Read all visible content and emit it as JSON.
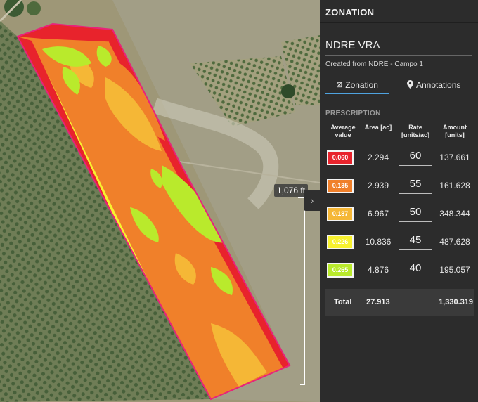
{
  "map": {
    "scale_label": "1,076 ft",
    "zone_colors": [
      "#e8232c",
      "#f0802a",
      "#f5b736",
      "#f8f22f",
      "#b9ea2c"
    ]
  },
  "panel": {
    "header": "ZONATION",
    "title": "NDRE VRA",
    "subtitle": "Created from NDRE - Campo 1",
    "tabs": [
      {
        "label": "Zonation",
        "icon": "zonation-icon"
      },
      {
        "label": "Annotations",
        "icon": "map-pin-icon"
      }
    ],
    "section": "PRESCRIPTION",
    "columns": {
      "avg": "Average value",
      "area": "Area [ac]",
      "rate": "Rate [units/ac]",
      "amount": "Amount [units]"
    },
    "rows": [
      {
        "value": "0.060",
        "color": "#e8232c",
        "area": "2.294",
        "rate": "60",
        "amount": "137.661"
      },
      {
        "value": "0.135",
        "color": "#f0802a",
        "area": "2.939",
        "rate": "55",
        "amount": "161.628"
      },
      {
        "value": "0.187",
        "color": "#f5b736",
        "area": "6.967",
        "rate": "50",
        "amount": "348.344"
      },
      {
        "value": "0.226",
        "color": "#f8f22f",
        "area": "10.836",
        "rate": "45",
        "amount": "487.628"
      },
      {
        "value": "0.265",
        "color": "#b9ea2c",
        "area": "4.876",
        "rate": "40",
        "amount": "195.057"
      }
    ],
    "total": {
      "label": "Total",
      "area": "27.913",
      "amount": "1,330.319"
    }
  }
}
